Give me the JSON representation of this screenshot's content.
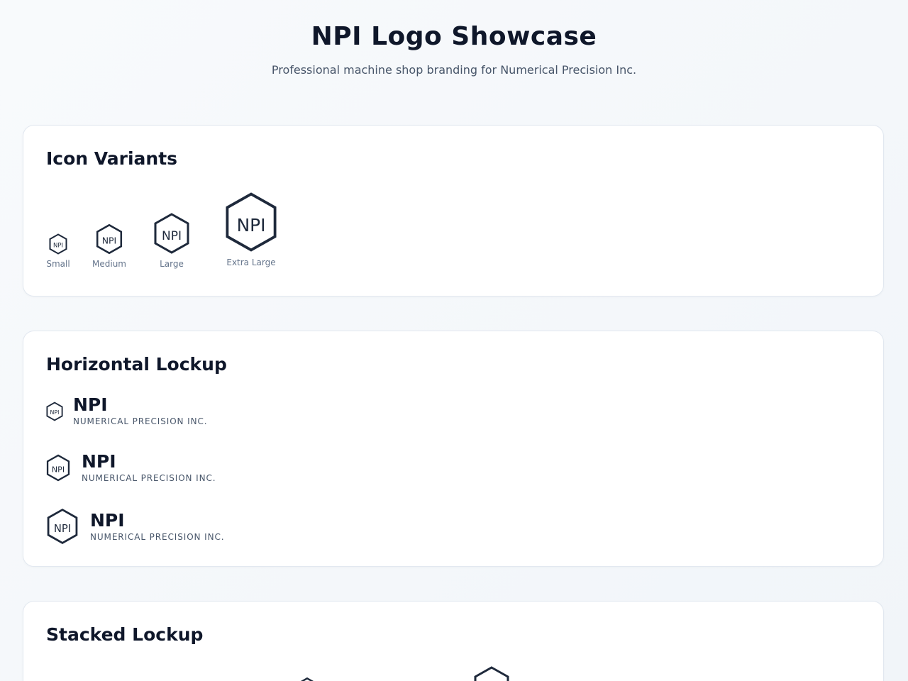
{
  "header": {
    "title": "NPI Logo Showcase",
    "subtitle": "Professional machine shop branding for Numerical Precision Inc."
  },
  "brand": {
    "primary_color": "#1e293b",
    "text_color": "#0f172a",
    "muted_color": "#64748b",
    "logo_mark": "NPI",
    "company_name": "NPI",
    "tagline": "NUMERICAL PRECISION INC."
  },
  "icon_variants": {
    "title": "Icon Variants",
    "items": [
      {
        "label": "Small"
      },
      {
        "label": "Medium"
      },
      {
        "label": "Large"
      },
      {
        "label": "Extra Large"
      }
    ]
  },
  "horizontal_lockup": {
    "title": "Horizontal Lockup",
    "items": [
      {
        "name": "NPI",
        "tagline": "NUMERICAL PRECISION INC."
      },
      {
        "name": "NPI",
        "tagline": "NUMERICAL PRECISION INC."
      },
      {
        "name": "NPI",
        "tagline": "NUMERICAL PRECISION INC."
      }
    ]
  },
  "stacked_lockup": {
    "title": "Stacked Lockup"
  }
}
